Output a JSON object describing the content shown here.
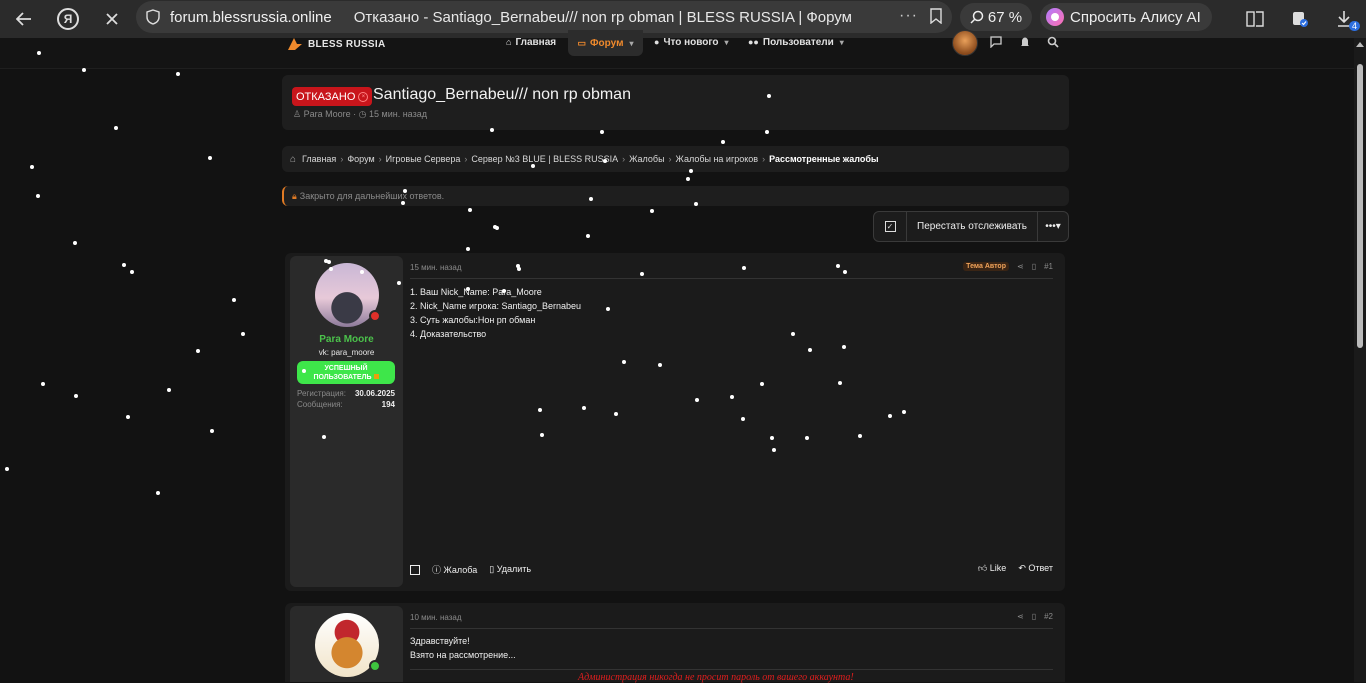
{
  "browser": {
    "domain": "forum.blessrussia.online",
    "page_title": "Отказано - Santiago_Bernabeu/// non rp obman | BLESS RUSSIA | Форум",
    "zoom": "67 %",
    "alice_label": "Спросить Алису AI",
    "downloads_count": "4",
    "more_glyph": "···"
  },
  "site": {
    "logo_text": "BLESS RUSSIA",
    "nav": {
      "home": "Главная",
      "forum": "Форум",
      "whats_new": "Что нового",
      "users": "Пользователи"
    }
  },
  "thread": {
    "prefix": "ОТКАЗАНО",
    "title": "Santiago_Bernabeu/// non rp obman",
    "author": "Para Moore",
    "time": "15 мин. назад",
    "locked_text": "Закрыто для дальнейших ответов.",
    "unwatch_label": "Перестать отслеживать",
    "more_label": "•••"
  },
  "breadcrumb": [
    "Главная",
    "Форум",
    "Игровые Сервера",
    "Сервер №3 BLUE | BLESS RUSSIA",
    "Жалобы",
    "Жалобы на игроков",
    "Рассмотренные жалобы"
  ],
  "posts": [
    {
      "username": "Para Moore",
      "user_title": "vk: para_moore",
      "banner": "УСПЕШНЫЙ ПОЛЬЗОВАТЕЛЬ",
      "reg_label": "Регистрация:",
      "reg_value": "30.06.2025",
      "msgs_label": "Сообщения:",
      "msgs_value": "194",
      "time": "15 мин. назад",
      "author_badge": "Тема Автор",
      "number": "#1",
      "lines": [
        "1. Ваш Nick_Name: Para_Moore",
        "2. Nick_Name игрока: Santiago_Bernabeu",
        "3. Суть жалобы:Нон рп обман",
        "4. Доказательство"
      ],
      "report_label": "Жалоба",
      "delete_label": "Удалить",
      "like_label": "Like",
      "reply_label": "Ответ"
    },
    {
      "time": "10 мин. назад",
      "number": "#2",
      "lines": [
        "Здравствуйте!",
        "Взято на рассмотрение..."
      ],
      "warning": "Администрация никогда не просит пароль от вашего аккаунта!"
    }
  ]
}
